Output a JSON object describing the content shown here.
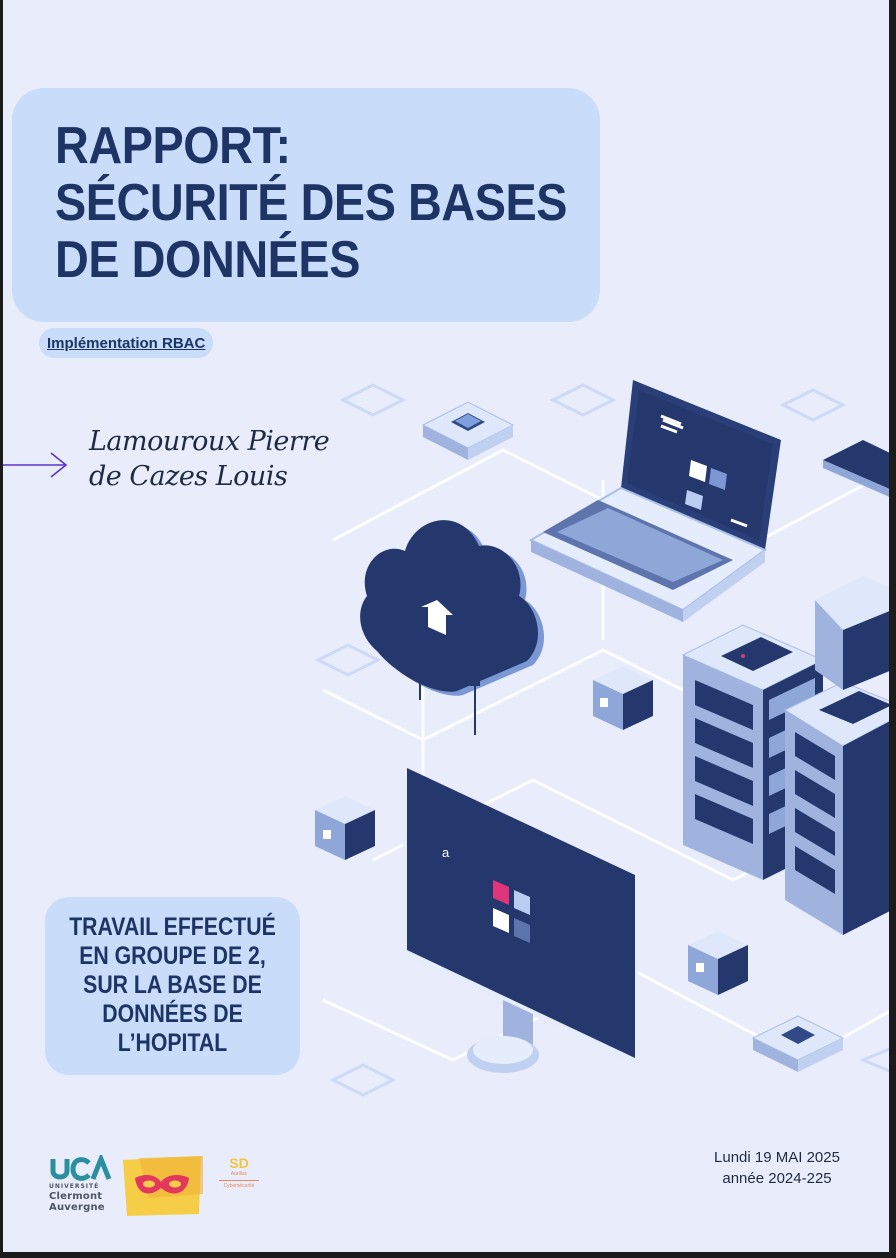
{
  "report": {
    "title_lines": [
      "RAPPORT:",
      "SÉCURITÉ DES BASES",
      "DE DONNÉES"
    ],
    "subtitle": "Implémentation RBAC",
    "authors": [
      "Lamouroux Pierre",
      "de Cazes Louis"
    ],
    "work_lines": [
      "TRAVAIL EFFECTUÉ",
      "EN GROUPE DE 2,",
      "SUR LA BASE DE",
      "DONNÉES DE",
      "L’HOPITAL"
    ],
    "date_line": "Lundi 19 MAI 2025",
    "year_line": "année 2024-225",
    "screen_char": "a"
  },
  "logos": {
    "uca": {
      "line1": "UNIVERSITÉ",
      "line2": "Clermont",
      "line3": "Auvergne"
    },
    "sd": {
      "big": "SD",
      "small1": "Aurillac",
      "small2": "Cybersécurité"
    }
  },
  "colors": {
    "page_bg": "#e9edfb",
    "box_bg": "#c9dcfa",
    "title_text": "#1d3465",
    "device_dark": "#25386e",
    "accent_pink": "#e0357a",
    "arrow": "#5b35c7"
  },
  "icons": [
    "arrow-right-icon",
    "cloud-upload-icon",
    "laptop-icon",
    "monitor-icon",
    "server-rack-icon"
  ]
}
